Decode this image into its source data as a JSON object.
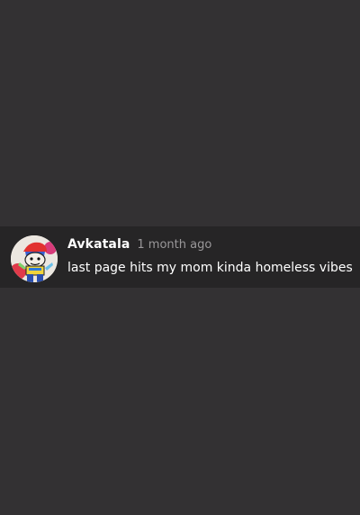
{
  "background_color": "#333133",
  "comment": {
    "username": "Avkatala",
    "timestamp": "1 month ago",
    "text": "last page hits my mom kinda homeless vibes",
    "avatar_icon": "user-avatar-cartoon",
    "row_color": "#262526"
  }
}
